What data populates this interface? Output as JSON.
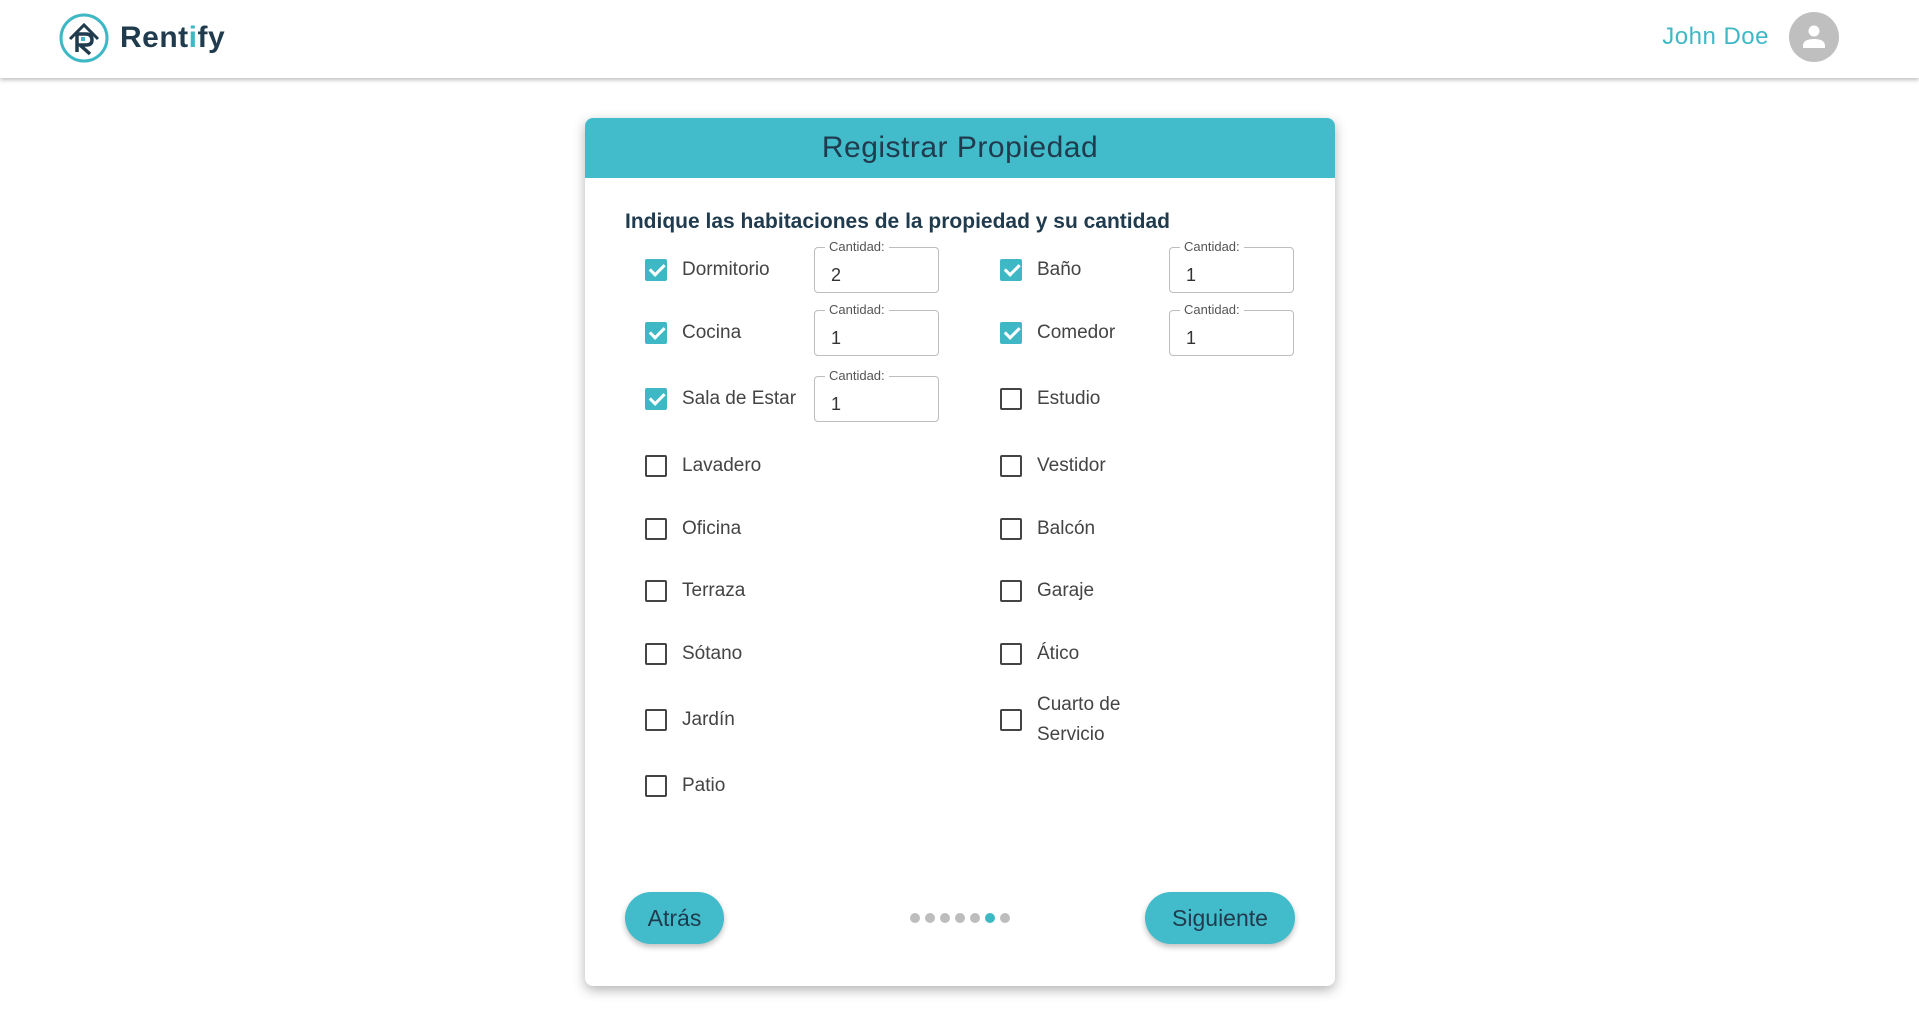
{
  "app": {
    "brand_prefix": "Rent",
    "brand_accent": "i",
    "brand_suffix": "fy"
  },
  "user": {
    "name": "John Doe"
  },
  "colors": {
    "accent": "#42bccb",
    "text_dark": "#1f3b4d",
    "dot_inactive": "#bdbdbd"
  },
  "card": {
    "title": "Registrar Propiedad",
    "question": "Indique las habitaciones de la propiedad y su cantidad"
  },
  "qty_label": "Cantidad:",
  "rooms": [
    {
      "label": "Dormitorio",
      "checked": true,
      "quantity": "2"
    },
    {
      "label": "Baño",
      "checked": true,
      "quantity": "1"
    },
    {
      "label": "Cocina",
      "checked": true,
      "quantity": "1"
    },
    {
      "label": "Comedor",
      "checked": true,
      "quantity": "1"
    },
    {
      "label": "Sala de Estar",
      "checked": true,
      "quantity": "1"
    },
    {
      "label": "Estudio",
      "checked": false
    },
    {
      "label": "Lavadero",
      "checked": false
    },
    {
      "label": "Vestidor",
      "checked": false
    },
    {
      "label": "Oficina",
      "checked": false
    },
    {
      "label": "Balcón",
      "checked": false
    },
    {
      "label": "Terraza",
      "checked": false
    },
    {
      "label": "Garaje",
      "checked": false
    },
    {
      "label": "Sótano",
      "checked": false
    },
    {
      "label": "Ático",
      "checked": false
    },
    {
      "label": "Jardín",
      "checked": false
    },
    {
      "label": "Cuarto de Servicio",
      "checked": false
    },
    {
      "label": "Patio",
      "checked": false
    }
  ],
  "footer": {
    "back_label": "Atrás",
    "next_label": "Siguiente",
    "steps_total": 7,
    "step_current": 6
  }
}
